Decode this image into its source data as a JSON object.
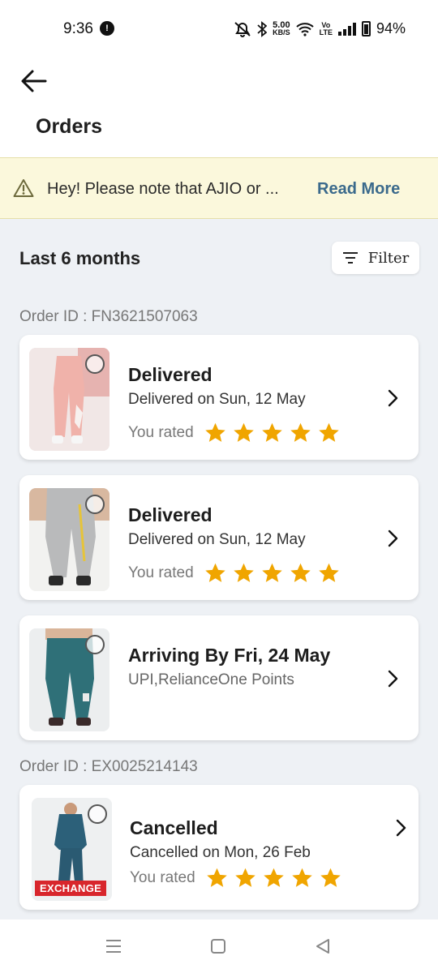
{
  "status_bar": {
    "time": "9:36",
    "notification_badge": "!",
    "net_speed_value": "5.00",
    "net_speed_unit": "KB/S",
    "lte_top": "Vo",
    "lte_bottom": "LTE",
    "battery": "94%",
    "icons": [
      "mute-icon",
      "bluetooth-icon",
      "wifi-icon",
      "signal-icon",
      "battery-icon"
    ]
  },
  "header": {
    "title": "Orders",
    "back_icon": "arrow-left-icon"
  },
  "notice": {
    "text": "Hey! Please note that AJIO or ...",
    "link": "Read More",
    "icon": "warning-icon"
  },
  "main": {
    "section_title": "Last 6 months",
    "filter_label": "Filter",
    "groups": [
      {
        "order_id": "Order ID : FN3621507063",
        "items": [
          {
            "status": "Delivered",
            "subtitle": "Delivered on Sun, 12 May",
            "rated_label": "You rated",
            "rating": 5,
            "image": "pink-joggers-product-image"
          },
          {
            "status": "Delivered",
            "subtitle": "Delivered on Sun, 12 May",
            "rated_label": "You rated",
            "rating": 5,
            "image": "grey-joggers-product-image"
          },
          {
            "status": "Arriving By Fri, 24 May",
            "subtitle": "UPI,RelianceOne Points",
            "image": "teal-joggers-product-image"
          }
        ]
      },
      {
        "order_id": "Order ID : EX0025214143",
        "items": [
          {
            "status": "Cancelled",
            "subtitle": "Cancelled on Mon, 26 Feb",
            "rated_label": "You rated",
            "rating": 5,
            "badge": "EXCHANGE",
            "image": "teal-tracksuit-product-image"
          }
        ]
      }
    ]
  },
  "colors": {
    "star": "#f0a500",
    "link": "#3b6a8c",
    "notice_bg": "#fbf8dc",
    "content_bg": "#eef1f5",
    "exchange_badge": "#d8262c"
  },
  "nav_bar": {
    "icons": [
      "menu-icon",
      "home-square-icon",
      "back-triangle-icon"
    ]
  }
}
